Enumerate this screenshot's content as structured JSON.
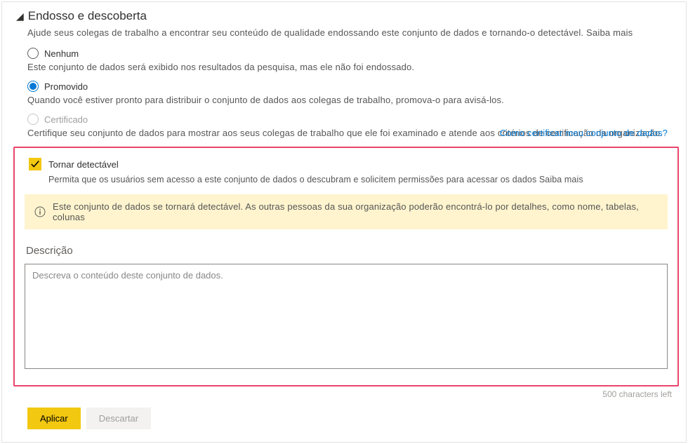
{
  "header": {
    "title": "Endosso e descoberta",
    "description": "Ajude seus colegas de trabalho a encontrar seu conteúdo de qualidade endossando este conjunto de dados e tornando-o detectável. Saiba mais"
  },
  "options": {
    "none": {
      "label": "Nenhum",
      "help": "Este conjunto de dados será exibido nos resultados da pesquisa, mas ele não foi endossado."
    },
    "promoted": {
      "label": "Promovido",
      "help": "Quando você estiver pronto para distribuir o conjunto de dados aos colegas de trabalho, promova-o para avisá-los."
    },
    "certified": {
      "label": "Certificado",
      "help": "Certifique seu conjunto de dados para mostrar aos seus colegas de trabalho que ele foi examinado e atende aos critérios de certificação da organização.",
      "link_text": "Como certificar meu conjunto de dados?"
    }
  },
  "discoverable": {
    "checkbox_label": "Tornar detectável",
    "help": "Permita que os usuários sem acesso a este conjunto de dados o descubram e solicitem permissões para acessar os dados Saiba mais",
    "info_text": "Este conjunto de dados se tornará detectável. As outras pessoas da sua organização poderão encontrá-lo por detalhes, como nome, tabelas, colunas"
  },
  "description": {
    "label": "Descrição",
    "placeholder": "Descreva o conteúdo deste conjunto de dados.",
    "char_count": "500 characters left"
  },
  "buttons": {
    "apply": "Aplicar",
    "discard": "Descartar"
  }
}
